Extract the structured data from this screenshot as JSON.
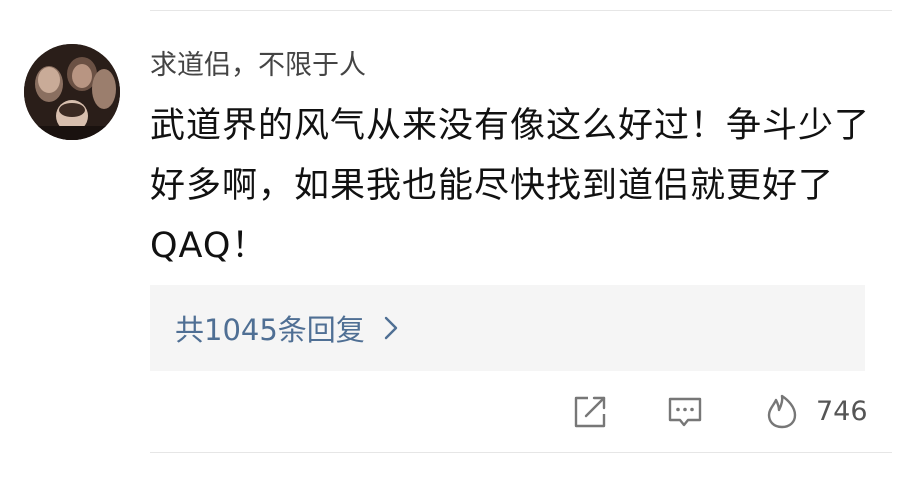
{
  "comment": {
    "username": "求道侣，不限于人",
    "text": "武道界的风气从来没有像这么好过！争斗少了好多啊，如果我也能尽快找到道侣就更好了QAQ！",
    "replies_label": "共1045条回复",
    "likes": "746"
  },
  "icons": {
    "share": "share-icon",
    "comment": "comment-icon",
    "like": "like-icon",
    "chevron": "chevron-right-icon"
  },
  "colors": {
    "link": "#4f6f94",
    "icon": "#777777",
    "reply_bg": "#f5f5f5"
  }
}
